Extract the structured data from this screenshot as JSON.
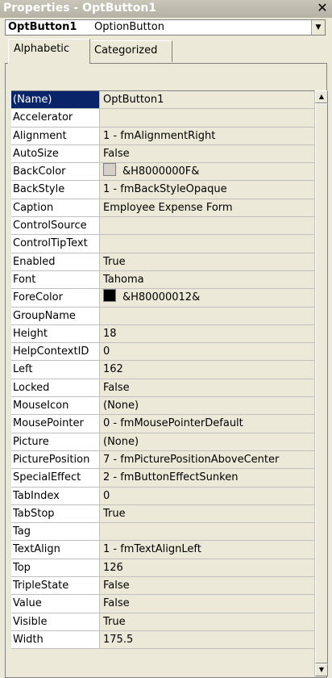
{
  "window": {
    "title": "Properties - OptButton1",
    "close_glyph": "✕"
  },
  "object_selector": {
    "name": "OptButton1",
    "type": "OptionButton",
    "dropdown_icon": "chevron-down-icon"
  },
  "tabs": [
    {
      "label": "Alphabetic",
      "active": true
    },
    {
      "label": "Categorized",
      "active": false
    }
  ],
  "properties": [
    {
      "name": "(Name)",
      "value": "OptButton1",
      "selected": true
    },
    {
      "name": "Accelerator",
      "value": ""
    },
    {
      "name": "Alignment",
      "value": "1 - fmAlignmentRight"
    },
    {
      "name": "AutoSize",
      "value": "False"
    },
    {
      "name": "BackColor",
      "value": "&H8000000F&",
      "swatch": "#d4d0c8"
    },
    {
      "name": "BackStyle",
      "value": "1 - fmBackStyleOpaque"
    },
    {
      "name": "Caption",
      "value": "Employee Expense Form"
    },
    {
      "name": "ControlSource",
      "value": ""
    },
    {
      "name": "ControlTipText",
      "value": ""
    },
    {
      "name": "Enabled",
      "value": "True"
    },
    {
      "name": "Font",
      "value": "Tahoma"
    },
    {
      "name": "ForeColor",
      "value": "&H80000012&",
      "swatch": "#000000"
    },
    {
      "name": "GroupName",
      "value": ""
    },
    {
      "name": "Height",
      "value": "18"
    },
    {
      "name": "HelpContextID",
      "value": "0"
    },
    {
      "name": "Left",
      "value": "162"
    },
    {
      "name": "Locked",
      "value": "False"
    },
    {
      "name": "MouseIcon",
      "value": "(None)"
    },
    {
      "name": "MousePointer",
      "value": "0 - fmMousePointerDefault"
    },
    {
      "name": "Picture",
      "value": "(None)"
    },
    {
      "name": "PicturePosition",
      "value": "7 - fmPicturePositionAboveCenter"
    },
    {
      "name": "SpecialEffect",
      "value": "2 - fmButtonEffectSunken"
    },
    {
      "name": "TabIndex",
      "value": "0"
    },
    {
      "name": "TabStop",
      "value": "True"
    },
    {
      "name": "Tag",
      "value": ""
    },
    {
      "name": "TextAlign",
      "value": "1 - fmTextAlignLeft"
    },
    {
      "name": "Top",
      "value": "126"
    },
    {
      "name": "TripleState",
      "value": "False"
    },
    {
      "name": "Value",
      "value": "False"
    },
    {
      "name": "Visible",
      "value": "True"
    },
    {
      "name": "Width",
      "value": "175.5"
    }
  ]
}
